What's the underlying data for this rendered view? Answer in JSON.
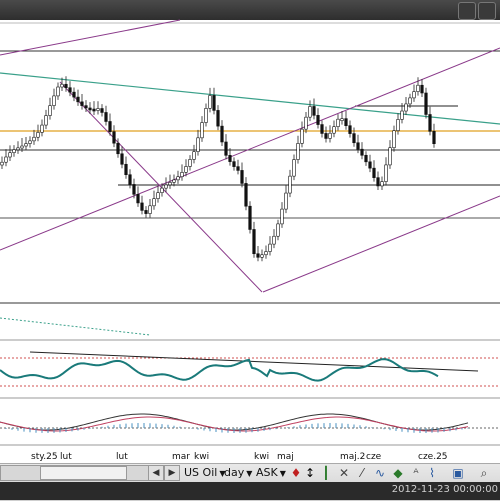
{
  "toolbar": {
    "instrument": "US Oil",
    "interval": "day",
    "price_side": "ASK"
  },
  "status": {
    "datetime": "2012-11-23 00:00:00"
  },
  "axis": {
    "labels": [
      "sty.25",
      "lut",
      "lut",
      "mar",
      "kwi",
      "kwi",
      "maj",
      "maj.2",
      "cze",
      "cze.25"
    ]
  },
  "icons": {
    "scroll_left": "arrow-left-icon",
    "scroll_right": "arrow-right-icon",
    "candles": "candlestick-icon",
    "indicators": "indicator-icon",
    "zoom": "zoom-icon"
  },
  "colors": {
    "background": "#ffffff",
    "frame": "#2b2b2b",
    "channel": "#8a3a8a",
    "trend": "#3aa08a",
    "level": "#e0a020",
    "indicator": "#1a7a7a"
  }
}
